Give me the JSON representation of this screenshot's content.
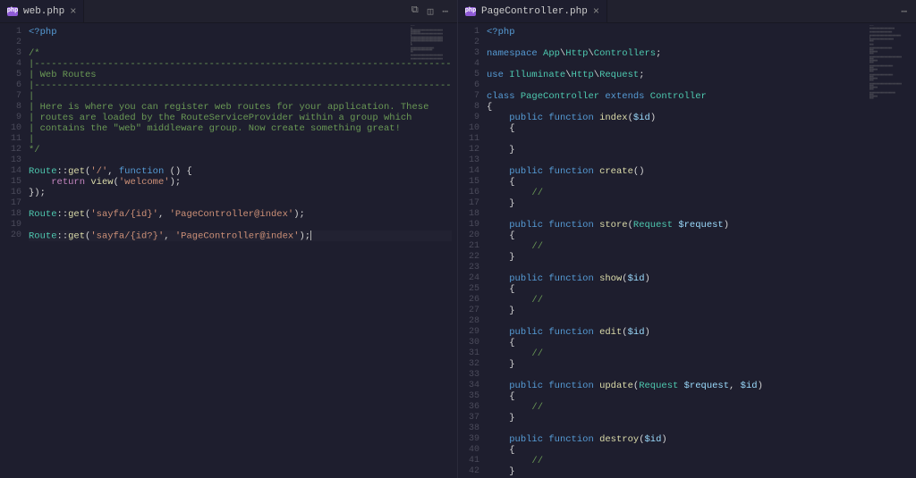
{
  "left": {
    "tab": {
      "icon_text": "php",
      "name": "web.php"
    },
    "actions": {
      "icon1_title": "open-changes",
      "icon2_title": "split",
      "icon3_title": "more"
    },
    "lines": [
      [
        {
          "cls": "k",
          "t": "<?php"
        }
      ],
      [],
      [
        {
          "cls": "c",
          "t": "/*"
        }
      ],
      [
        {
          "cls": "c",
          "t": "|--------------------------------------------------------------------------"
        }
      ],
      [
        {
          "cls": "c",
          "t": "| Web Routes"
        }
      ],
      [
        {
          "cls": "c",
          "t": "|--------------------------------------------------------------------------"
        }
      ],
      [
        {
          "cls": "c",
          "t": "|"
        }
      ],
      [
        {
          "cls": "c",
          "t": "| Here is where you can register web routes for your application. These"
        }
      ],
      [
        {
          "cls": "c",
          "t": "| routes are loaded by the RouteServiceProvider within a group which"
        }
      ],
      [
        {
          "cls": "c",
          "t": "| contains the \"web\" middleware group. Now create something great!"
        }
      ],
      [
        {
          "cls": "c",
          "t": "|"
        }
      ],
      [
        {
          "cls": "c",
          "t": "*/"
        }
      ],
      [],
      [
        {
          "cls": "t",
          "t": "Route"
        },
        {
          "cls": "p",
          "t": "::"
        },
        {
          "cls": "fn",
          "t": "get"
        },
        {
          "cls": "p",
          "t": "("
        },
        {
          "cls": "s",
          "t": "'/'"
        },
        {
          "cls": "p",
          "t": ", "
        },
        {
          "cls": "k",
          "t": "function"
        },
        {
          "cls": "p",
          "t": " () {"
        }
      ],
      [
        {
          "cls": "p",
          "t": "    "
        },
        {
          "cls": "kw",
          "t": "return"
        },
        {
          "cls": "p",
          "t": " "
        },
        {
          "cls": "fn",
          "t": "view"
        },
        {
          "cls": "p",
          "t": "("
        },
        {
          "cls": "s",
          "t": "'welcome'"
        },
        {
          "cls": "p",
          "t": ");"
        }
      ],
      [
        {
          "cls": "p",
          "t": "});"
        }
      ],
      [],
      [
        {
          "cls": "t",
          "t": "Route"
        },
        {
          "cls": "p",
          "t": "::"
        },
        {
          "cls": "fn",
          "t": "get"
        },
        {
          "cls": "p",
          "t": "("
        },
        {
          "cls": "s",
          "t": "'sayfa/{id}'"
        },
        {
          "cls": "p",
          "t": ", "
        },
        {
          "cls": "s",
          "t": "'PageController@index'"
        },
        {
          "cls": "p",
          "t": ");"
        }
      ],
      [],
      [
        {
          "cls": "t",
          "t": "Route"
        },
        {
          "cls": "p",
          "t": "::"
        },
        {
          "cls": "fn",
          "t": "get"
        },
        {
          "cls": "p",
          "t": "("
        },
        {
          "cls": "s",
          "t": "'sayfa/{id?}'"
        },
        {
          "cls": "p",
          "t": ", "
        },
        {
          "cls": "s",
          "t": "'PageController@index'"
        },
        {
          "cls": "p",
          "t": ");"
        }
      ]
    ],
    "cursor_line": 20
  },
  "right": {
    "tab": {
      "icon_text": "php",
      "name": "PageController.php"
    },
    "lines": [
      [
        {
          "cls": "k",
          "t": "<?php"
        }
      ],
      [],
      [
        {
          "cls": "k",
          "t": "namespace"
        },
        {
          "cls": "p",
          "t": " "
        },
        {
          "cls": "t",
          "t": "App"
        },
        {
          "cls": "p",
          "t": "\\"
        },
        {
          "cls": "t",
          "t": "Http"
        },
        {
          "cls": "p",
          "t": "\\"
        },
        {
          "cls": "t",
          "t": "Controllers"
        },
        {
          "cls": "p",
          "t": ";"
        }
      ],
      [],
      [
        {
          "cls": "k",
          "t": "use"
        },
        {
          "cls": "p",
          "t": " "
        },
        {
          "cls": "t",
          "t": "Illuminate"
        },
        {
          "cls": "p",
          "t": "\\"
        },
        {
          "cls": "t",
          "t": "Http"
        },
        {
          "cls": "p",
          "t": "\\"
        },
        {
          "cls": "t",
          "t": "Request"
        },
        {
          "cls": "p",
          "t": ";"
        }
      ],
      [],
      [
        {
          "cls": "k",
          "t": "class"
        },
        {
          "cls": "p",
          "t": " "
        },
        {
          "cls": "t",
          "t": "PageController"
        },
        {
          "cls": "p",
          "t": " "
        },
        {
          "cls": "k",
          "t": "extends"
        },
        {
          "cls": "p",
          "t": " "
        },
        {
          "cls": "t",
          "t": "Controller"
        }
      ],
      [
        {
          "cls": "p",
          "t": "{"
        }
      ],
      [
        {
          "cls": "p",
          "t": "    "
        },
        {
          "cls": "k",
          "t": "public"
        },
        {
          "cls": "p",
          "t": " "
        },
        {
          "cls": "k",
          "t": "function"
        },
        {
          "cls": "p",
          "t": " "
        },
        {
          "cls": "fn",
          "t": "index"
        },
        {
          "cls": "p",
          "t": "("
        },
        {
          "cls": "v",
          "t": "$id"
        },
        {
          "cls": "p",
          "t": ")"
        }
      ],
      [
        {
          "cls": "p",
          "t": "    {"
        }
      ],
      [],
      [
        {
          "cls": "p",
          "t": "    }"
        }
      ],
      [],
      [
        {
          "cls": "p",
          "t": "    "
        },
        {
          "cls": "k",
          "t": "public"
        },
        {
          "cls": "p",
          "t": " "
        },
        {
          "cls": "k",
          "t": "function"
        },
        {
          "cls": "p",
          "t": " "
        },
        {
          "cls": "fn",
          "t": "create"
        },
        {
          "cls": "p",
          "t": "()"
        }
      ],
      [
        {
          "cls": "p",
          "t": "    {"
        }
      ],
      [
        {
          "cls": "p",
          "t": "        "
        },
        {
          "cls": "c",
          "t": "//"
        }
      ],
      [
        {
          "cls": "p",
          "t": "    }"
        }
      ],
      [],
      [
        {
          "cls": "p",
          "t": "    "
        },
        {
          "cls": "k",
          "t": "public"
        },
        {
          "cls": "p",
          "t": " "
        },
        {
          "cls": "k",
          "t": "function"
        },
        {
          "cls": "p",
          "t": " "
        },
        {
          "cls": "fn",
          "t": "store"
        },
        {
          "cls": "p",
          "t": "("
        },
        {
          "cls": "t",
          "t": "Request"
        },
        {
          "cls": "p",
          "t": " "
        },
        {
          "cls": "v",
          "t": "$request"
        },
        {
          "cls": "p",
          "t": ")"
        }
      ],
      [
        {
          "cls": "p",
          "t": "    {"
        }
      ],
      [
        {
          "cls": "p",
          "t": "        "
        },
        {
          "cls": "c",
          "t": "//"
        }
      ],
      [
        {
          "cls": "p",
          "t": "    }"
        }
      ],
      [],
      [
        {
          "cls": "p",
          "t": "    "
        },
        {
          "cls": "k",
          "t": "public"
        },
        {
          "cls": "p",
          "t": " "
        },
        {
          "cls": "k",
          "t": "function"
        },
        {
          "cls": "p",
          "t": " "
        },
        {
          "cls": "fn",
          "t": "show"
        },
        {
          "cls": "p",
          "t": "("
        },
        {
          "cls": "v",
          "t": "$id"
        },
        {
          "cls": "p",
          "t": ")"
        }
      ],
      [
        {
          "cls": "p",
          "t": "    {"
        }
      ],
      [
        {
          "cls": "p",
          "t": "        "
        },
        {
          "cls": "c",
          "t": "//"
        }
      ],
      [
        {
          "cls": "p",
          "t": "    }"
        }
      ],
      [],
      [
        {
          "cls": "p",
          "t": "    "
        },
        {
          "cls": "k",
          "t": "public"
        },
        {
          "cls": "p",
          "t": " "
        },
        {
          "cls": "k",
          "t": "function"
        },
        {
          "cls": "p",
          "t": " "
        },
        {
          "cls": "fn",
          "t": "edit"
        },
        {
          "cls": "p",
          "t": "("
        },
        {
          "cls": "v",
          "t": "$id"
        },
        {
          "cls": "p",
          "t": ")"
        }
      ],
      [
        {
          "cls": "p",
          "t": "    {"
        }
      ],
      [
        {
          "cls": "p",
          "t": "        "
        },
        {
          "cls": "c",
          "t": "//"
        }
      ],
      [
        {
          "cls": "p",
          "t": "    }"
        }
      ],
      [],
      [
        {
          "cls": "p",
          "t": "    "
        },
        {
          "cls": "k",
          "t": "public"
        },
        {
          "cls": "p",
          "t": " "
        },
        {
          "cls": "k",
          "t": "function"
        },
        {
          "cls": "p",
          "t": " "
        },
        {
          "cls": "fn",
          "t": "update"
        },
        {
          "cls": "p",
          "t": "("
        },
        {
          "cls": "t",
          "t": "Request"
        },
        {
          "cls": "p",
          "t": " "
        },
        {
          "cls": "v",
          "t": "$request"
        },
        {
          "cls": "p",
          "t": ", "
        },
        {
          "cls": "v",
          "t": "$id"
        },
        {
          "cls": "p",
          "t": ")"
        }
      ],
      [
        {
          "cls": "p",
          "t": "    {"
        }
      ],
      [
        {
          "cls": "p",
          "t": "        "
        },
        {
          "cls": "c",
          "t": "//"
        }
      ],
      [
        {
          "cls": "p",
          "t": "    }"
        }
      ],
      [],
      [
        {
          "cls": "p",
          "t": "    "
        },
        {
          "cls": "k",
          "t": "public"
        },
        {
          "cls": "p",
          "t": " "
        },
        {
          "cls": "k",
          "t": "function"
        },
        {
          "cls": "p",
          "t": " "
        },
        {
          "cls": "fn",
          "t": "destroy"
        },
        {
          "cls": "p",
          "t": "("
        },
        {
          "cls": "v",
          "t": "$id"
        },
        {
          "cls": "p",
          "t": ")"
        }
      ],
      [
        {
          "cls": "p",
          "t": "    {"
        }
      ],
      [
        {
          "cls": "p",
          "t": "        "
        },
        {
          "cls": "c",
          "t": "//"
        }
      ],
      [
        {
          "cls": "p",
          "t": "    }"
        }
      ]
    ]
  }
}
